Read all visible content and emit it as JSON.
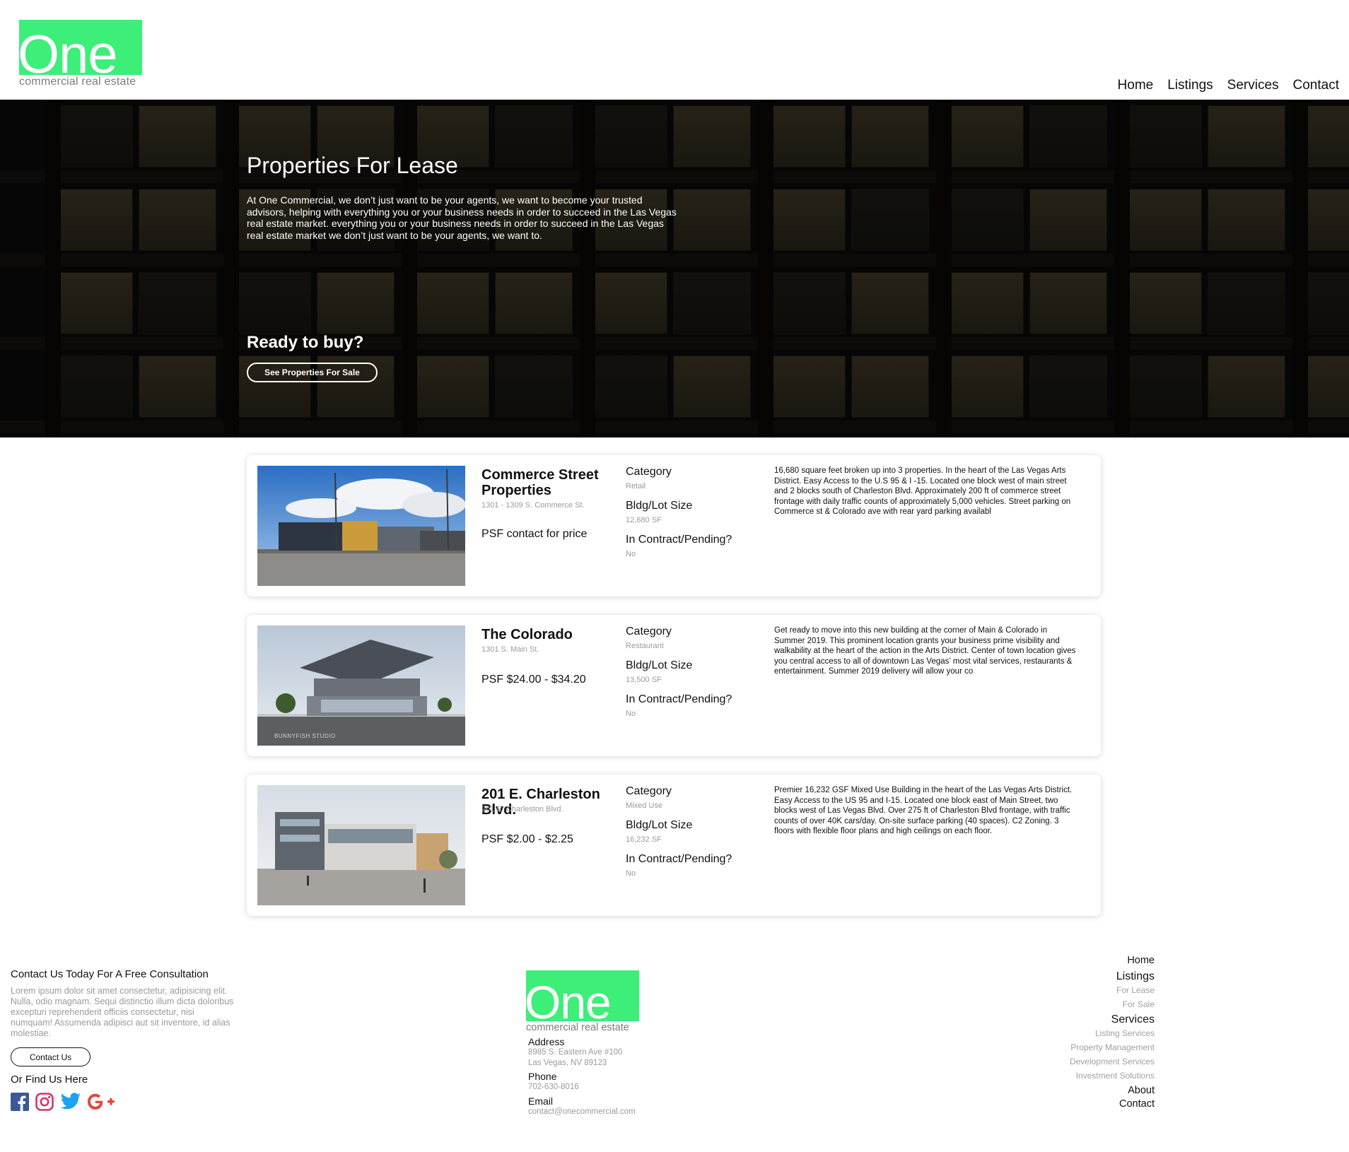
{
  "brand": {
    "logo_word": "One",
    "logo_tagline": "commercial real estate",
    "accent": "#3dee79"
  },
  "nav": {
    "items": [
      "Home",
      "Listings",
      "Services",
      "Contact"
    ]
  },
  "hero": {
    "title": "Properties For Lease",
    "text": "At One Commercial, we don’t just want to be your agents, we want to become your trusted advisors, helping with everything you or your business needs in order to succeed in the Las Vegas real estate market. everything you or your business needs in order to succeed in the Las Vegas real estate market we don’t just want to be your agents, we want to.",
    "ready_heading": "Ready to buy?",
    "button_label": "See Properties For Sale"
  },
  "listings": [
    {
      "name": "Commerce Street Properties",
      "address": "1301 - 1309 S. Commerce St.",
      "price": "PSF contact for price",
      "category_label": "Category",
      "category": "Retail",
      "size_label": "Bldg/Lot Size",
      "size": "12,680 SF",
      "contract_label": "In Contract/Pending?",
      "contract": "No",
      "description": "16,680 square feet broken up into 3 properties. In the heart of the Las Vegas Arts District. Easy Access to the U.S 95 & I -15. Located one block west of main street and 2 blocks south of Charleston Blvd. Approximately 200 ft of commerce street frontage with daily traffic counts of approximately 5,000 vehicles. Street parking on Commerce st & Colorado ave with rear yard parking availabl"
    },
    {
      "name": "The Colorado",
      "address": "1301 S. Main St.",
      "price": "PSF $24.00 - $34.20",
      "category_label": "Category",
      "category": "Restaurant",
      "size_label": "Bldg/Lot Size",
      "size": "13,500 SF",
      "contract_label": "In Contract/Pending?",
      "contract": "No",
      "description": "Get ready to move into this new building at the corner of Main & Colorado in Summer 2019. This prominent location grants your business prime visibility and walkability at the heart of the action in the Arts District. Center of town location gives you central access to all of downtown Las Vegas’ most vital services, restaurants & entertainment. Summer 2019 delivery will allow your co",
      "photo_watermark": "BUNNYFISH STUDIO"
    },
    {
      "name": "201 E. Charleston Blvd.",
      "address": "201 E. Charleston Blvd.",
      "price": "PSF $2.00 - $2.25",
      "category_label": "Category",
      "category": "Mixed Use",
      "size_label": "Bldg/Lot Size",
      "size": "16,232 SF",
      "contract_label": "In Contract/Pending?",
      "contract": "No",
      "description": "Premier 16,232 GSF Mixed Use Building in the heart of the Las Vegas Arts District.  Easy Access to the US 95 and I-15.  Located one block east of Main Street, two blocks west of Las Vegas Blvd.  Over 275 ft of Charleston Blvd frontage, with traffic counts of over 40K cars/day.  On-site surface parking (40 spaces).  C2 Zoning.  3 floors with flexible floor plans and high ceilings on each floor."
    }
  ],
  "footer": {
    "consult_heading": "Contact Us Today For A Free Consultation",
    "lorem": "Lorem ipsum dolor sit amet consectetur, adipisicing elit. Nulla, odio magnam. Sequi distinctio illum dicta doloribus excepturi reprehenderit officiis consectetur, nisi numquam! Assumenda adipisci aut sit inventore, id alias molestiae.",
    "contact_button": "Contact Us",
    "find_us": "Or Find Us Here",
    "social_icons": [
      "facebook-icon",
      "instagram-icon",
      "twitter-icon",
      "google-plus-icon"
    ],
    "address_label": "Address",
    "address_line1": "8985 S. Eastern Ave #100",
    "address_line2": "Las Vegas, NV 89123",
    "phone_label": "Phone",
    "phone": "702-630-8016",
    "email_label": "Email",
    "email": "contact@onecommercial.com",
    "links": {
      "home": "Home",
      "listings": "Listings",
      "for_lease": "For Lease",
      "for_sale": "For Sale",
      "services": "Services",
      "listing_services": "Listing Services",
      "property_management": "Property Management",
      "development_services": "Development Services",
      "investment_solutions": "Investment Solutions",
      "about": "About",
      "contact": "Contact"
    }
  }
}
